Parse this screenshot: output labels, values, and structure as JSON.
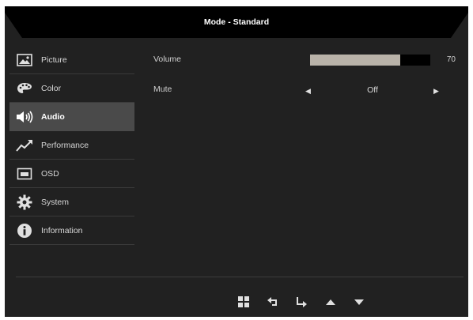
{
  "header": {
    "title": "Mode - Standard"
  },
  "sidebar": {
    "items": [
      {
        "label": "Picture",
        "icon": "picture-icon",
        "active": false
      },
      {
        "label": "Color",
        "icon": "palette-icon",
        "active": false
      },
      {
        "label": "Audio",
        "icon": "speaker-icon",
        "active": true
      },
      {
        "label": "Performance",
        "icon": "trend-up-icon",
        "active": false
      },
      {
        "label": "OSD",
        "icon": "osd-window-icon",
        "active": false
      },
      {
        "label": "System",
        "icon": "gear-icon",
        "active": false
      },
      {
        "label": "Information",
        "icon": "info-icon",
        "active": false
      }
    ]
  },
  "main": {
    "volume": {
      "label": "Volume",
      "value": "70",
      "level": 0.75,
      "fill_color": "#b9b3a9"
    },
    "mute": {
      "label": "Mute",
      "value": "Off"
    }
  },
  "footer": {
    "buttons": [
      "windows-grid-icon",
      "back-arrow-icon",
      "enter-arrow-icon",
      "up-triangle-icon",
      "down-triangle-icon"
    ]
  },
  "colors": {
    "background": "#212121",
    "active_item": "#4a4a4a",
    "header_bar": "#000000"
  }
}
